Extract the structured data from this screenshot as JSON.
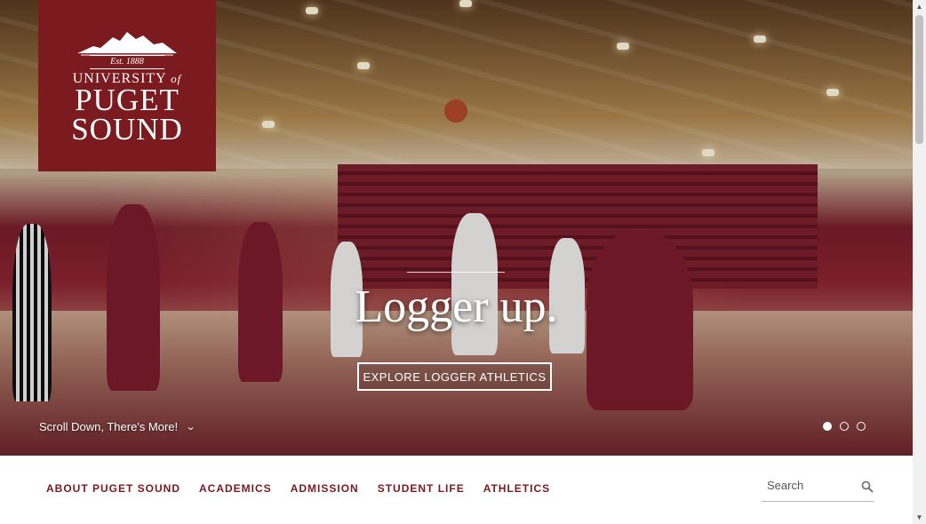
{
  "logo": {
    "est": "Est. 1888",
    "line1": "UNIVERSITY",
    "line1_of": "of",
    "line2": "PUGET",
    "line3": "SOUND"
  },
  "hero": {
    "headline": "Logger up.",
    "cta_label": "EXPLORE LOGGER ATHLETICS",
    "scroll_label": "Scroll Down, There's More!",
    "slides": 3,
    "active_slide": 1
  },
  "nav": {
    "items": [
      {
        "label": "ABOUT PUGET SOUND"
      },
      {
        "label": "ACADEMICS"
      },
      {
        "label": "ADMISSION"
      },
      {
        "label": "STUDENT LIFE"
      },
      {
        "label": "ATHLETICS"
      }
    ]
  },
  "search": {
    "placeholder": "Search",
    "icon": "search-icon"
  },
  "colors": {
    "brand": "#7b1a1f",
    "nav_text": "#7b1a1f"
  }
}
